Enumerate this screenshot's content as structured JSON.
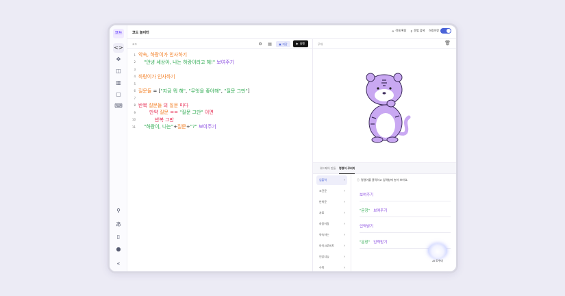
{
  "app": {
    "logo_text": "코드",
    "title": "코드 놀이터"
  },
  "header": {
    "expand_label": "작게 확장",
    "search_label": "문법 검색",
    "mode_label": "하랑이랑",
    "mode_on": true
  },
  "editor": {
    "label": "코드",
    "save_label": "저장",
    "run_label": "실행",
    "lines": [
      {
        "num": "1",
        "indent": 0,
        "tokens": [
          {
            "t": "약속, 하랑이가 인사하기",
            "c": "orange"
          }
        ]
      },
      {
        "num": "2",
        "indent": 1,
        "tokens": [
          {
            "t": "\"안녕 세상아, 나는 하랑이라고 해!\"",
            "c": "green"
          },
          {
            "t": " 보여주기",
            "c": "purple"
          }
        ]
      },
      {
        "num": "3",
        "indent": 0,
        "tokens": []
      },
      {
        "num": "4",
        "indent": 0,
        "tokens": [
          {
            "t": "하랑이가 인사하기",
            "c": "orange"
          }
        ]
      },
      {
        "num": "5",
        "indent": 0,
        "tokens": []
      },
      {
        "num": "6",
        "indent": 0,
        "tokens": [
          {
            "t": "질문들",
            "c": "orange"
          },
          {
            "t": " = [",
            "c": "black"
          },
          {
            "t": "\"지금 뭐 해\"",
            "c": "green"
          },
          {
            "t": ", ",
            "c": "black"
          },
          {
            "t": "\"무엇을 좋아해\"",
            "c": "green"
          },
          {
            "t": ", ",
            "c": "black"
          },
          {
            "t": "\"질문 그만\"",
            "c": "green"
          },
          {
            "t": "]",
            "c": "black"
          }
        ]
      },
      {
        "num": "7",
        "indent": 0,
        "tokens": []
      },
      {
        "num": "8",
        "indent": 0,
        "tokens": [
          {
            "t": "반복 ",
            "c": "red"
          },
          {
            "t": "질문들",
            "c": "orange"
          },
          {
            "t": " 의 ",
            "c": "red"
          },
          {
            "t": "질문",
            "c": "orange"
          },
          {
            "t": " 마다",
            "c": "red"
          }
        ]
      },
      {
        "num": "9",
        "indent": 2,
        "tokens": [
          {
            "t": "만약 ",
            "c": "red"
          },
          {
            "t": "질문",
            "c": "orange"
          },
          {
            "t": " == ",
            "c": "red"
          },
          {
            "t": "\"질문 그만\"",
            "c": "green"
          },
          {
            "t": " 이면",
            "c": "red"
          }
        ]
      },
      {
        "num": "10",
        "indent": 3,
        "tokens": [
          {
            "t": "반복 그만",
            "c": "red"
          }
        ]
      },
      {
        "num": "11",
        "indent": 1,
        "tokens": [
          {
            "t": "\"하랑이, 나는\"",
            "c": "green"
          },
          {
            "t": "+",
            "c": "black"
          },
          {
            "t": "질문",
            "c": "orange"
          },
          {
            "t": "+",
            "c": "black"
          },
          {
            "t": "\"?\"",
            "c": "green"
          },
          {
            "t": " 보여주기",
            "c": "purple"
          }
        ]
      }
    ]
  },
  "stage": {
    "label": "무대"
  },
  "panel": {
    "tabs": [
      {
        "label": "워드페어 만들",
        "active": false
      },
      {
        "label": "명령어 꾸러미",
        "active": true
      }
    ],
    "categories": [
      {
        "label": "입출력",
        "active": true
      },
      {
        "label": "조건문",
        "active": false
      },
      {
        "label": "반복문",
        "active": false
      },
      {
        "label": "자료",
        "active": false
      },
      {
        "label": "하랑이랑",
        "active": false
      },
      {
        "label": "약속하는",
        "active": false
      },
      {
        "label": "아이크로비트",
        "active": false
      },
      {
        "label": "인공지능",
        "active": false
      },
      {
        "label": "수학",
        "active": false
      }
    ],
    "hint": "명령어를 클릭하고 입력창에 놓아 보아요.",
    "blocks": [
      {
        "parts": [
          {
            "t": "보여주기",
            "c": "purple"
          }
        ]
      },
      {
        "parts": [
          {
            "t": "\"문장\"",
            "c": "green"
          },
          {
            "t": "보여주기",
            "c": "purple"
          }
        ]
      },
      {
        "parts": [
          {
            "t": "입력받기",
            "c": "purple"
          }
        ]
      },
      {
        "parts": [
          {
            "t": "\"문장\"",
            "c": "green"
          },
          {
            "t": "입력받기",
            "c": "purple"
          }
        ]
      }
    ],
    "ai_label": "AI 도우미"
  },
  "colors": {
    "accent": "#4a63d8",
    "orange": "#f27c20",
    "green": "#2ca94f",
    "purple": "#8a4ce0",
    "red": "#e62b52",
    "black": "#222222",
    "tiger": "#c9a8f2"
  }
}
